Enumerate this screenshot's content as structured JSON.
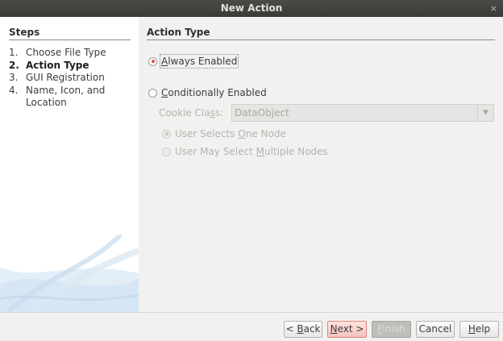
{
  "window": {
    "title": "New Action",
    "close_glyph": "×"
  },
  "steps": {
    "heading": "Steps",
    "items": [
      {
        "num": "1.",
        "label": "Choose File Type"
      },
      {
        "num": "2.",
        "label": "Action Type"
      },
      {
        "num": "3.",
        "label": "GUI Registration"
      },
      {
        "num": "4.",
        "label": "Name, Icon, and Location"
      }
    ],
    "current_index": 1
  },
  "content": {
    "heading": "Action Type",
    "always_enabled": {
      "mnemonic": "A",
      "rest": "lways Enabled",
      "selected": true
    },
    "conditionally_enabled": {
      "mnemonic": "C",
      "rest": "onditionally Enabled",
      "selected": false
    },
    "cookie_class": {
      "label_pre": "Cookie Cla",
      "mnemonic": "s",
      "label_post": "s:",
      "value": "DataObject",
      "enabled": false
    },
    "one_node": {
      "pre": "User Selects ",
      "mnemonic": "O",
      "post": "ne Node",
      "selected": true,
      "enabled": false
    },
    "multiple_nodes": {
      "pre": "User May Select ",
      "mnemonic": "M",
      "post": "ultiple Nodes",
      "selected": false,
      "enabled": false
    }
  },
  "footer": {
    "back": {
      "pre": "< ",
      "mnemonic": "B",
      "post": "ack"
    },
    "next": {
      "pre": "",
      "mnemonic": "N",
      "post": "ext >"
    },
    "finish": {
      "pre": "",
      "mnemonic": "F",
      "post": "inish",
      "enabled": false
    },
    "cancel": {
      "label": "Cancel"
    },
    "help": {
      "pre": "",
      "mnemonic": "H",
      "post": "elp"
    }
  },
  "colors": {
    "accent_radio": "#e0533a",
    "next_button_bg": "#f6c4bd",
    "titlebar": "#3f3f3c"
  },
  "icons": {
    "close": "close-icon",
    "dropdown": "chevron-down-icon",
    "decoration": "wave-decoration"
  }
}
